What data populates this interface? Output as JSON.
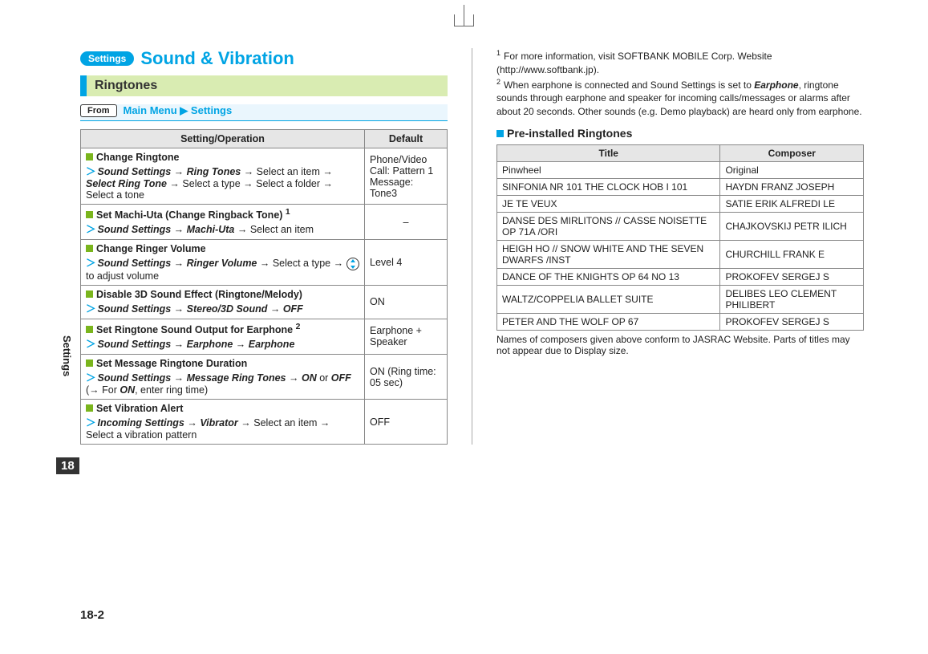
{
  "header": {
    "badge": "Settings",
    "title": "Sound & Vibration"
  },
  "section": "Ringtones",
  "from": {
    "label": "From",
    "path1": "Main Menu",
    "sep": "▶",
    "path2": "Settings"
  },
  "table_headers": {
    "op": "Setting/Operation",
    "def": "Default"
  },
  "settings": [
    {
      "title": "Change Ringtone",
      "path_html": "<span class='bold-i'>Sound Settings</span> → <span class='bold-i'>Ring Tones</span> → Select an item → <span class='bold-i'>Select Ring Tone</span> → Select a type → Select a folder → Select a tone",
      "default_html": "Phone/Video Call: Pattern 1<br>Message: Tone3"
    },
    {
      "title": "Set Machi-Uta (Change Ringback Tone) ",
      "title_sup": "1",
      "path_html": "<span class='bold-i'>Sound Settings</span> → <span class='bold-i'>Machi-Uta</span> → Select an item",
      "default_html": "–"
    },
    {
      "title": "Change Ringer Volume",
      "path_html": "<span class='bold-i'>Sound Settings</span> → <span class='bold-i'>Ringer Volume</span> → Select a type → <span data-name='dial-icon' class='dial-icon'></span> to adjust volume",
      "default_html": "Level 4"
    },
    {
      "title": "Disable 3D Sound Effect (Ringtone/Melody)",
      "path_html": "<span class='bold-i'>Sound Settings</span> → <span class='bold-i'>Stereo/3D Sound</span> → <span class='bold-i'>OFF</span>",
      "default_html": "ON"
    },
    {
      "title": "Set Ringtone Sound Output for Earphone ",
      "title_sup": "2",
      "path_html": "<span class='bold-i'>Sound Settings</span> → <span class='bold-i'>Earphone</span> → <span class='bold-i'>Earphone</span>",
      "default_html": "Earphone + Speaker"
    },
    {
      "title": "Set Message Ringtone Duration",
      "path_html": "<span class='bold-i'>Sound Settings</span> → <span class='bold-i'>Message Ring Tones</span> → <span class='bold-i'>ON</span> or <span class='bold-i'>OFF</span> (→ For <span class='bold-i'>ON</span>, enter ring time)",
      "default_html": "ON (Ring time: 05 sec)"
    },
    {
      "title": "Set Vibration Alert",
      "path_html": "<span class='bold-i'>Incoming Settings</span> → <span class='bold-i'>Vibrator</span> → Select an item → Select a vibration pattern",
      "default_html": "OFF"
    }
  ],
  "footnotes": [
    {
      "n": "1",
      "text": "For more information, visit SOFTBANK MOBILE Corp. Website (http://www.softbank.jp)."
    },
    {
      "n": "2",
      "text_html": "When earphone is connected and Sound Settings is set to <span class='bold-i'>Earphone</span>, ringtone sounds through earphone and speaker for incoming calls/messages or alarms after about 20 seconds. Other sounds (e.g. Demo playback) are heard only from earphone."
    }
  ],
  "subheader": "Pre-installed Ringtones",
  "ringtones_headers": {
    "title": "Title",
    "composer": "Composer"
  },
  "ringtones": [
    {
      "title": "Pinwheel",
      "composer": "Original"
    },
    {
      "title": "SINFONIA NR 101 THE CLOCK HOB I 101",
      "composer": "HAYDN FRANZ JOSEPH"
    },
    {
      "title": "JE TE VEUX",
      "composer": "SATIE ERIK ALFREDI LE"
    },
    {
      "title": "DANSE DES MIRLITONS // CASSE NOISETTE OP 71A /ORI",
      "composer": "CHAJKOVSKIJ PETR ILICH"
    },
    {
      "title": "HEIGH HO // SNOW WHITE AND THE SEVEN DWARFS /INST",
      "composer": "CHURCHILL FRANK E"
    },
    {
      "title": "DANCE OF THE KNIGHTS OP 64 NO 13",
      "composer": "PROKOFEV SERGEJ S"
    },
    {
      "title": "WALTZ/COPPELIA BALLET SUITE",
      "composer": "DELIBES LEO CLEMENT PHILIBERT"
    },
    {
      "title": "PETER AND THE WOLF OP 67",
      "composer": "PROKOFEV SERGEJ S"
    }
  ],
  "ringtones_note": "Names of composers given above conform to JASRAC Website. Parts of titles may not appear due to Display size.",
  "side_tab": "Settings",
  "side_num": "18",
  "page_num": "18-2"
}
